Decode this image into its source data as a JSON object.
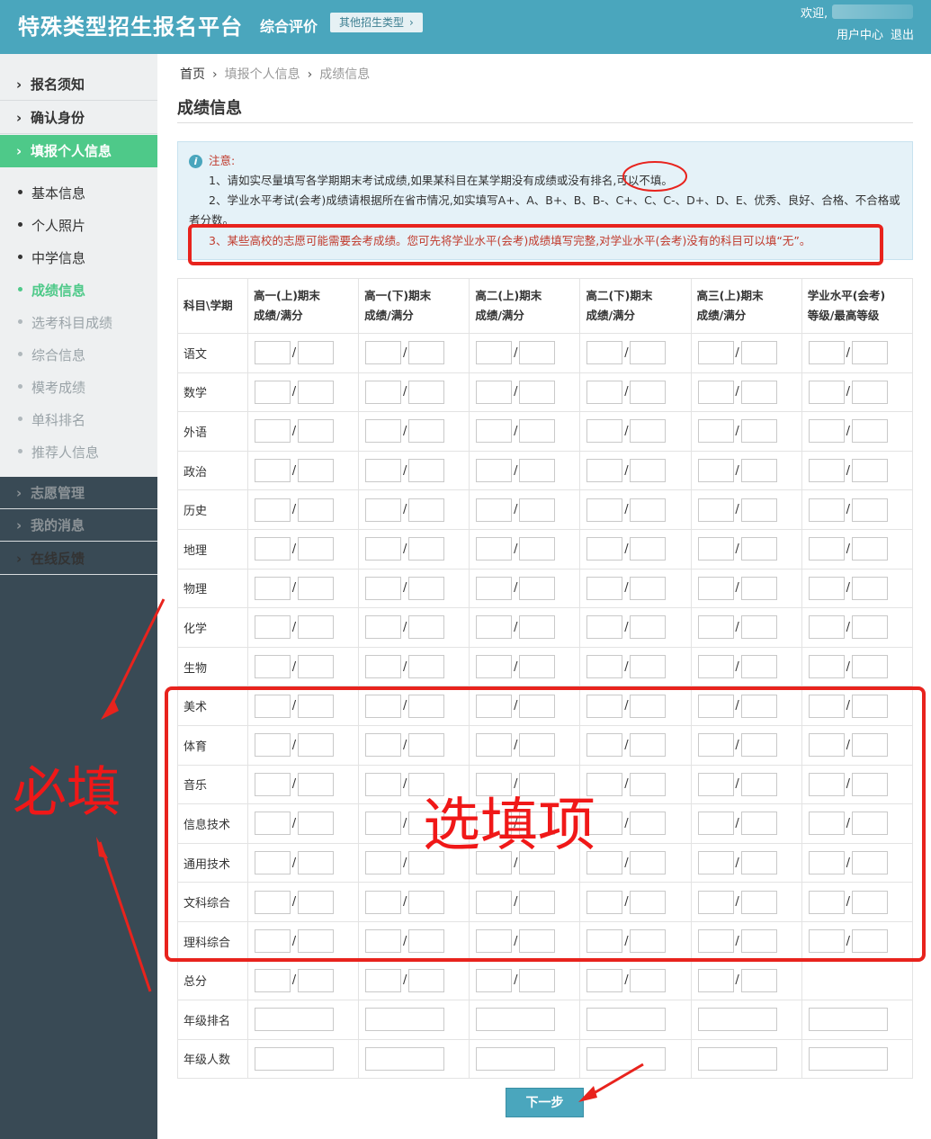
{
  "header": {
    "logo": "特殊类型招生报名平台",
    "subtitle": "综合评价",
    "other_types": "其他招生类型",
    "welcome": "欢迎,",
    "user_center": "用户中心",
    "logout": "退出"
  },
  "sidebar": {
    "items": [
      {
        "label": "报名须知"
      },
      {
        "label": "确认身份"
      },
      {
        "label": "填报个人信息"
      },
      {
        "label": "志愿管理"
      },
      {
        "label": "我的消息"
      },
      {
        "label": "在线反馈"
      }
    ],
    "sub_items": [
      {
        "label": "基本信息"
      },
      {
        "label": "个人照片"
      },
      {
        "label": "中学信息"
      },
      {
        "label": "成绩信息"
      },
      {
        "label": "选考科目成绩"
      },
      {
        "label": "综合信息"
      },
      {
        "label": "模考成绩"
      },
      {
        "label": "单科排名"
      },
      {
        "label": "推荐人信息"
      }
    ]
  },
  "breadcrumb": [
    "首页",
    "填报个人信息",
    "成绩信息"
  ],
  "page_title": "成绩信息",
  "notice": {
    "label": "注意:",
    "line1": "1、请如实尽量填写各学期期末考试成绩,如果某科目在某学期没有成绩或没有排名,可以不填。",
    "line2": "2、学业水平考试(会考)成绩请根据所在省市情况,如实填写A+、A、B+、B、B-、C+、C、C-、D+、D、E、优秀、良好、合格、不合格或者分数。",
    "line3": "3、某些高校的志愿可能需要会考成绩。您可先将学业水平(会考)成绩填写完整,对学业水平(会考)没有的科目可以填“无”。"
  },
  "table": {
    "corner": "科目\\学期",
    "columns": [
      {
        "line1": "高一(上)期末",
        "line2": "成绩/满分"
      },
      {
        "line1": "高一(下)期末",
        "line2": "成绩/满分"
      },
      {
        "line1": "高二(上)期末",
        "line2": "成绩/满分"
      },
      {
        "line1": "高二(下)期末",
        "line2": "成绩/满分"
      },
      {
        "line1": "高三(上)期末",
        "line2": "成绩/满分"
      },
      {
        "line1": "学业水平(会考)",
        "line2": "等级/最高等级"
      }
    ],
    "score_rows": [
      "语文",
      "数学",
      "外语",
      "政治",
      "历史",
      "地理",
      "物理",
      "化学",
      "生物",
      "美术",
      "体育",
      "音乐",
      "信息技术",
      "通用技术",
      "文科综合",
      "理科综合"
    ],
    "total_row": "总分",
    "rank_rows": [
      "年级排名",
      "年级人数"
    ],
    "separator": "/"
  },
  "next_button": "下一步",
  "annotations": {
    "required": "必填",
    "optional": "选填项",
    "color": "#f01818"
  }
}
